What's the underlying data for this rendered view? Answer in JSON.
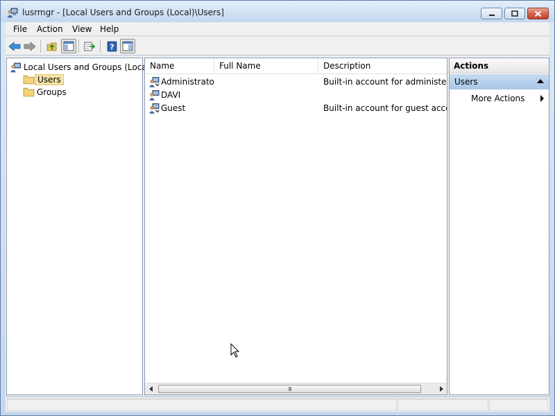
{
  "window": {
    "title": "lusrmgr - [Local Users and Groups (Local)\\Users]",
    "app_icon": "users-computer-icon"
  },
  "menubar": {
    "items": [
      "File",
      "Action",
      "View",
      "Help"
    ]
  },
  "toolbar": {
    "buttons": [
      {
        "icon": "back-arrow-icon"
      },
      {
        "icon": "forward-arrow-icon"
      },
      {
        "icon": "up-folder-icon"
      },
      {
        "icon": "show-hide-console-tree-icon"
      },
      {
        "icon": "export-list-icon"
      },
      {
        "icon": "help-icon"
      },
      {
        "icon": "show-hide-action-pane-icon"
      }
    ]
  },
  "tree": {
    "root": "Local Users and Groups (Local)",
    "children": [
      {
        "label": "Users",
        "selected": true
      },
      {
        "label": "Groups",
        "selected": false
      }
    ]
  },
  "list": {
    "columns": [
      "Name",
      "Full Name",
      "Description"
    ],
    "rows": [
      {
        "name": "Administrator",
        "full_name": "",
        "description": "Built-in account for administering"
      },
      {
        "name": "DAVI",
        "full_name": "",
        "description": ""
      },
      {
        "name": "Guest",
        "full_name": "",
        "description": "Built-in account for guest access t"
      }
    ],
    "scroll_grip": "III"
  },
  "actions": {
    "title": "Actions",
    "section": "Users",
    "items": [
      "More Actions"
    ]
  },
  "colors": {
    "selection_bg": "#f3e6a7",
    "actions_section_bg": "#b8d0ec",
    "close_button": "#c9533b"
  }
}
